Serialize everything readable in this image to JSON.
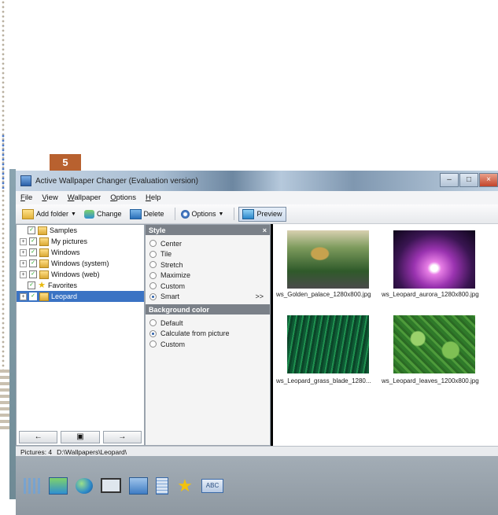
{
  "step_badge": "5",
  "window": {
    "title": "Active Wallpaper Changer (Evaluation version)",
    "controls": [
      "–",
      "□",
      "×"
    ]
  },
  "menu": [
    {
      "key": "F",
      "rest": "ile"
    },
    {
      "key": "V",
      "rest": "iew"
    },
    {
      "key": "W",
      "rest": "allpaper"
    },
    {
      "key": "O",
      "rest": "ptions"
    },
    {
      "key": "H",
      "rest": "elp"
    }
  ],
  "toolbar": {
    "add_folder": "Add folder",
    "change": "Change",
    "delete": "Delete",
    "options": "Options",
    "preview": "Preview"
  },
  "tree": {
    "items": [
      {
        "label": "Samples",
        "expander": "",
        "checked": "✓",
        "icon": "folder"
      },
      {
        "label": "My pictures",
        "expander": "+",
        "checked": "✓",
        "icon": "folder"
      },
      {
        "label": "Windows",
        "expander": "+",
        "checked": "✓",
        "icon": "folder"
      },
      {
        "label": "Windows (system)",
        "expander": "+",
        "checked": "✓",
        "icon": "folder"
      },
      {
        "label": "Windows (web)",
        "expander": "+",
        "checked": "✓",
        "icon": "folder"
      },
      {
        "label": "Favorites",
        "expander": "",
        "checked": "✓",
        "icon": "star"
      },
      {
        "label": "Leopard",
        "expander": "+",
        "checked": "✓",
        "icon": "folder",
        "selected": true
      }
    ],
    "nav": [
      "←",
      "▣",
      "→"
    ]
  },
  "style_panel": {
    "header": "Style",
    "close": "×",
    "options": [
      {
        "label": "Center",
        "selected": false
      },
      {
        "label": "Tile",
        "selected": false
      },
      {
        "label": "Stretch",
        "selected": false
      },
      {
        "label": "Maximize",
        "selected": false
      },
      {
        "label": "Custom",
        "selected": false
      },
      {
        "label": "Smart",
        "selected": true
      }
    ],
    "more": ">>",
    "bg_header": "Background color",
    "bg_options": [
      {
        "label": "Default",
        "selected": false
      },
      {
        "label": "Calculate from picture",
        "selected": true
      },
      {
        "label": "Custom",
        "selected": false
      }
    ]
  },
  "preview": {
    "thumbnails": [
      {
        "caption": "ws_Golden_palace_1280x800.jpg"
      },
      {
        "caption": "ws_Leopard_aurora_1280x800.jpg"
      },
      {
        "caption": "ws_Leopard_grass_blade_1280..."
      },
      {
        "caption": "ws_Leopard_leaves_1200x800.jpg"
      }
    ]
  },
  "status": {
    "count": "Pictures: 4",
    "path": "D:\\Wallpapers\\Leopard\\"
  },
  "taskbar": {
    "icons": [
      "grid-icon",
      "picture-icon",
      "globe-icon",
      "monitor-icon",
      "book-icon",
      "document-icon",
      "star-icon",
      "abc-icon"
    ],
    "abc_text": "ABC",
    "close": "×"
  }
}
